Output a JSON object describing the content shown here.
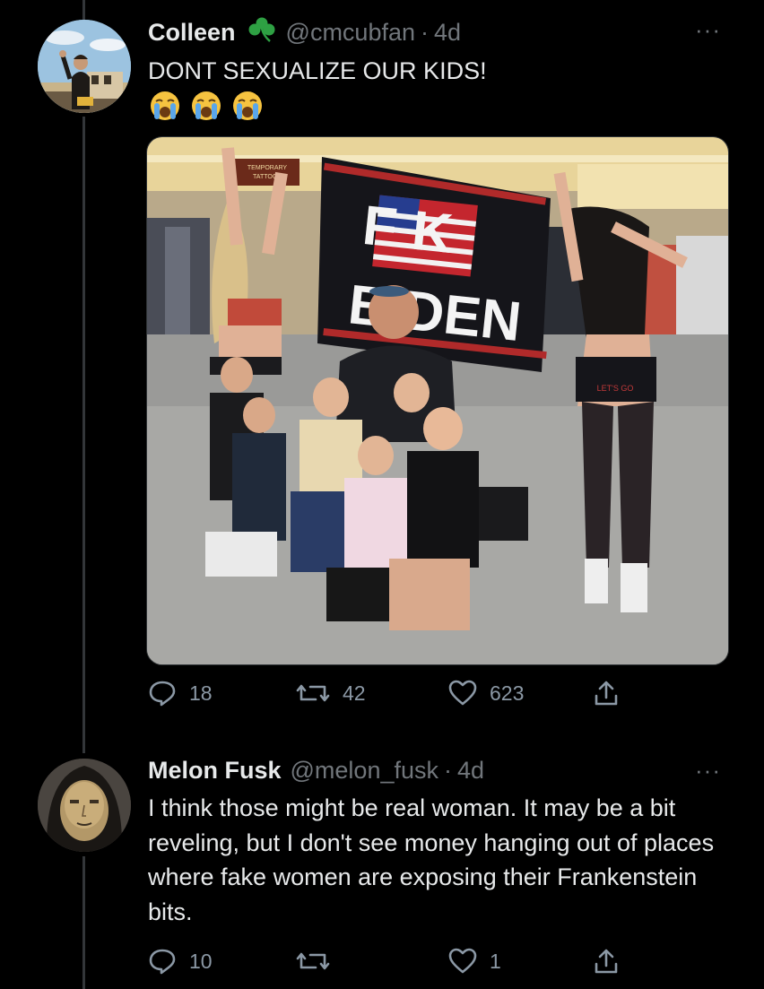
{
  "thread": [
    {
      "display_name": "Colleen",
      "name_emoji": "shamrock-icon",
      "handle": "@cmcubfan",
      "separator": "·",
      "time": "4d",
      "more_label": "···",
      "text": "DONT SEXUALIZE OUR KIDS!",
      "emojis": [
        "loudly-crying-face",
        "loudly-crying-face",
        "loudly-crying-face"
      ],
      "media": {
        "flag_text_1": "F K",
        "flag_text_2": "BIDEN",
        "sign_text": "TEMPORARY TATTOOS",
        "shorts_text": "LET'S GO BRANDON"
      },
      "actions": {
        "replies": "18",
        "retweets": "42",
        "likes": "623"
      }
    },
    {
      "display_name": "Melon Fusk",
      "handle": "@melon_fusk",
      "separator": "·",
      "time": "4d",
      "more_label": "···",
      "text": "I think those might be real woman. It may be a bit reveling, but I don't see money hanging out of places where fake women are exposing their Frankenstein bits.",
      "actions": {
        "replies": "10",
        "retweets": "",
        "likes": "1"
      }
    }
  ],
  "colors": {
    "background": "#000000",
    "text_primary": "#e7e9ea",
    "text_secondary": "#71767b",
    "shamrock": "#2ea043",
    "thread_line": "#333639"
  }
}
